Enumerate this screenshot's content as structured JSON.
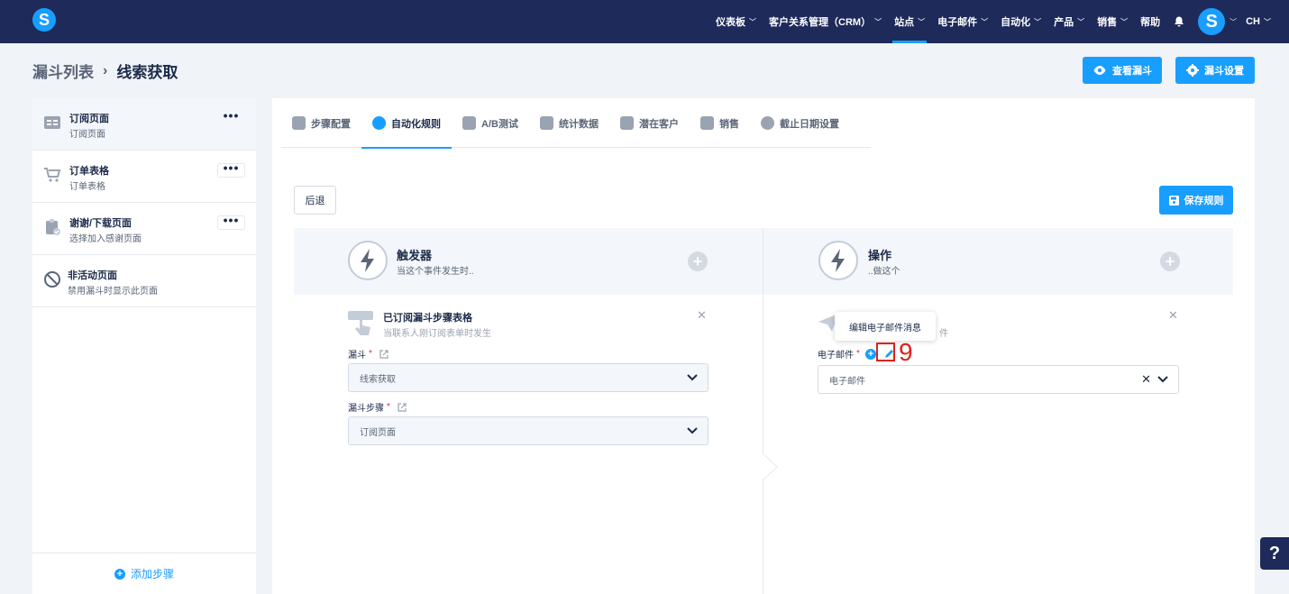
{
  "nav": {
    "items": [
      {
        "label": "仪表板",
        "chevron": true
      },
      {
        "label": "客户关系管理（CRM）",
        "chevron": true
      },
      {
        "label": "站点",
        "chevron": true,
        "active": true
      },
      {
        "label": "电子邮件",
        "chevron": true
      },
      {
        "label": "自动化",
        "chevron": true
      },
      {
        "label": "产品",
        "chevron": true
      },
      {
        "label": "销售",
        "chevron": true
      },
      {
        "label": "帮助",
        "chevron": false
      }
    ],
    "user_initials": "CH",
    "logo_letter": "S",
    "avatar_letter": "S"
  },
  "breadcrumb": {
    "parent": "漏斗列表",
    "current": "线索获取"
  },
  "header_buttons": {
    "view": "查看漏斗",
    "settings": "漏斗设置"
  },
  "steps": [
    {
      "title": "订阅页面",
      "subtitle": "订阅页面",
      "icon": "form-icon",
      "active": true,
      "menu": "•••"
    },
    {
      "title": "订单表格",
      "subtitle": "订单表格",
      "icon": "cart-icon",
      "active": false,
      "menu": "•••"
    },
    {
      "title": "谢谢/下载页面",
      "subtitle": "选择加入感谢页面",
      "icon": "clipboard-check-icon",
      "active": false,
      "menu": "•••"
    },
    {
      "title": "非活动页面",
      "subtitle": "禁用漏斗时显示此页面",
      "icon": "ban-icon",
      "active": false,
      "menu": ""
    }
  ],
  "add_step": "添加步骤",
  "tabs": [
    {
      "label": "步骤配置",
      "active": false
    },
    {
      "label": "自动化规则",
      "active": true
    },
    {
      "label": "A/B测试",
      "active": false
    },
    {
      "label": "统计数据",
      "active": false
    },
    {
      "label": "潜在客户",
      "active": false
    },
    {
      "label": "销售",
      "active": false
    },
    {
      "label": "截止日期设置",
      "active": false
    }
  ],
  "buttons": {
    "back": "后退",
    "save_rule": "保存规则"
  },
  "trigger": {
    "title": "触发器",
    "subtitle": "当这个事件发生时..",
    "card_title": "已订阅漏斗步骤表格",
    "card_subtitle": "当联系人刚订阅表单时发生",
    "funnel_label": "漏斗",
    "funnel_value": "线索获取",
    "step_label": "漏斗步骤",
    "step_value": "订阅页面"
  },
  "action": {
    "title": "操作",
    "subtitle": "..做这个",
    "card_subtitle_tail": "件",
    "email_label": "电子邮件",
    "email_placeholder": "电子邮件"
  },
  "tooltip": "编辑电子邮件消息",
  "annotation_number": "9",
  "help": "?",
  "colors": {
    "navy": "#1e2a5a",
    "accent": "#189eff",
    "annotation": "#e0201b"
  }
}
